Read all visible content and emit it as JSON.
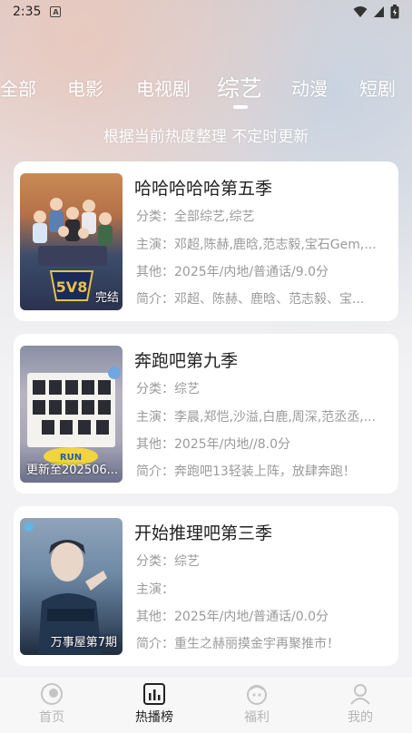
{
  "status": {
    "time": "2:35",
    "notif": "A"
  },
  "tabs": [
    {
      "label": "全部",
      "active": false
    },
    {
      "label": "电影",
      "active": false
    },
    {
      "label": "电视剧",
      "active": false
    },
    {
      "label": "综艺",
      "active": true
    },
    {
      "label": "动漫",
      "active": false
    },
    {
      "label": "短剧",
      "active": false
    }
  ],
  "subtitle": "根据当前热度整理 不定时更新",
  "cards": [
    {
      "title": "哈哈哈哈哈第五季",
      "category": "分类：全部综艺,综艺",
      "cast": "主演：邓超,陈赫,鹿晗,范志毅,宝石Gem,...",
      "other": "其他：2025年/内地/普通话/9.0分",
      "intro": "简介：邓超、陈赫、鹿晗、范志毅、宝...",
      "badge": "完结"
    },
    {
      "title": "奔跑吧第九季",
      "category": "分类：综艺",
      "cast": "主演：李晨,郑恺,沙溢,白鹿,周深,范丞丞,...",
      "other": "其他：2025年/内地//8.0分",
      "intro": "简介：奔跑吧13轻装上阵，放肆奔跑！",
      "badge": "更新至202506..."
    },
    {
      "title": "开始推理吧第三季",
      "category": "分类：综艺",
      "cast": "主演：",
      "other": "其他：2025年/内地/普通话/0.0分",
      "intro": "简介：重生之赫丽摸金宇再聚推市！",
      "badge": "万事屋第7期"
    }
  ],
  "nav": [
    {
      "label": "首页",
      "icon": "home-icon",
      "active": false
    },
    {
      "label": "热播榜",
      "icon": "chart-icon",
      "active": true
    },
    {
      "label": "福利",
      "icon": "welfare-icon",
      "active": false
    },
    {
      "label": "我的",
      "icon": "profile-icon",
      "active": false
    }
  ],
  "colors": {
    "active_text": "#222222",
    "inactive_text": "#b5b5b5",
    "meta_text": "#9a9a9a"
  }
}
